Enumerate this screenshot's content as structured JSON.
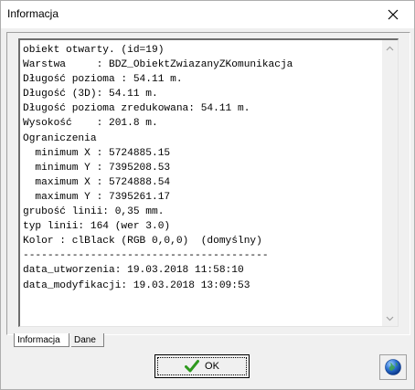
{
  "window": {
    "title": "Informacja"
  },
  "memo": {
    "text": "obiekt otwarty. (id=19)\nWarstwa     : BDZ_ObiektZwiazanyZKomunikacja\nDługość pozioma : 54.11 m.\nDługość (3D): 54.11 m.\nDługość pozioma zredukowana: 54.11 m.\nWysokość    : 201.8 m.\nOgraniczenia\n  minimum X : 5724885.15\n  minimum Y : 7395208.53\n  maximum X : 5724888.54\n  maximum Y : 7395261.17\ngrubość linii: 0,35 mm.\ntyp linii: 164 (wer 3.0)\nKolor : clBlack (RGB 0,0,0)  (domyślny)\n----------------------------------------\ndata_utworzenia: 19.03.2018 11:58:10\ndata_modyfikacji: 19.03.2018 13:09:53"
  },
  "tabs": [
    {
      "label": "Informacja",
      "active": true
    },
    {
      "label": "Dane",
      "active": false
    }
  ],
  "buttons": {
    "ok_label": "OK"
  },
  "icons": {
    "close": "close-icon",
    "ok": "checkmark-icon",
    "globe": "globe-icon",
    "scroll_up": "scroll-up-arrow-icon",
    "scroll_down": "scroll-down-arrow-icon"
  },
  "colors": {
    "check_green": "#2e9a1e",
    "globe_blue": "#2a6fd0"
  }
}
